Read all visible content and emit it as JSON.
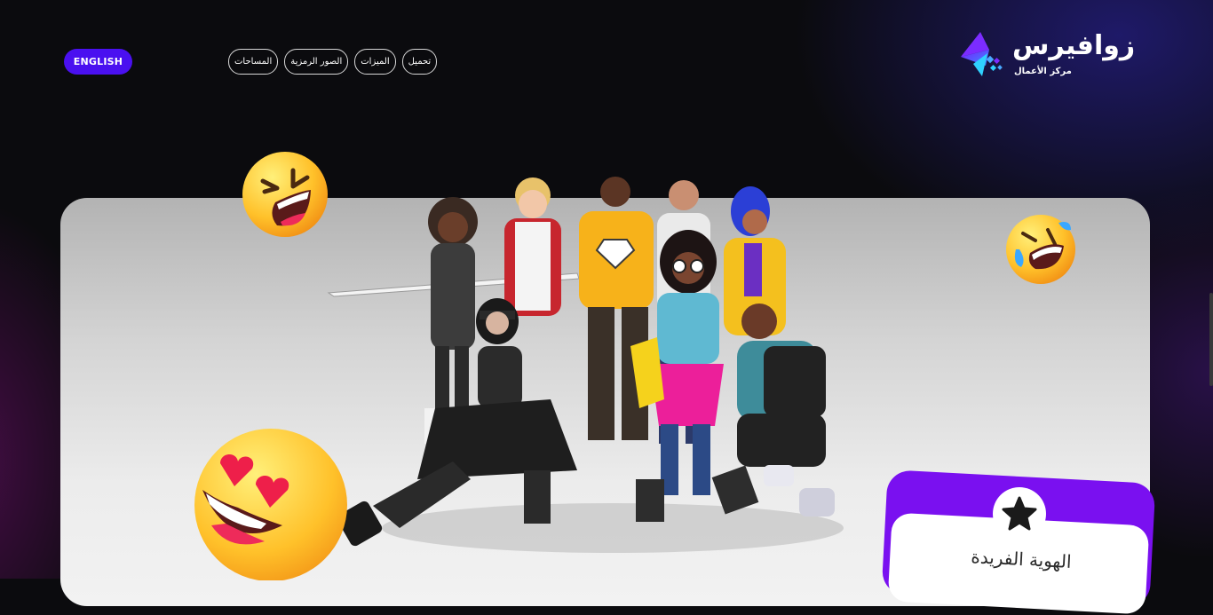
{
  "header": {
    "language_button": "ENGLISH",
    "nav": [
      {
        "label": "تحميل"
      },
      {
        "label": "الميزات"
      },
      {
        "label": "الصور الرمزية"
      },
      {
        "label": "المساحات"
      }
    ],
    "logo": {
      "name": "زوافيرس",
      "tagline": "مركز الأعمال"
    }
  },
  "feature_card": {
    "title": "الهوية الفريدة",
    "icon": "star-icon"
  },
  "colors": {
    "accent": "#4a10f0",
    "card_purple": "#7a10f0",
    "background": "#0b0b0e"
  }
}
